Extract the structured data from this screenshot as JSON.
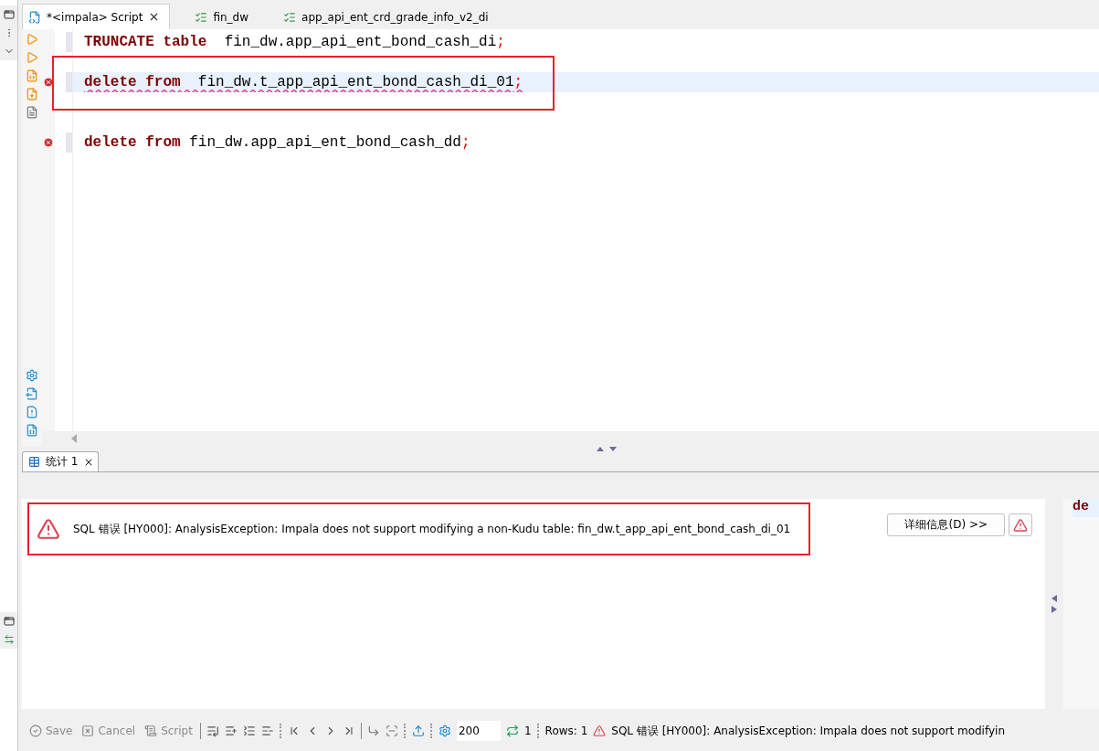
{
  "editor_tabs": [
    {
      "label": "*<impala> Script",
      "kind": "script",
      "selected": true,
      "closable": true
    },
    {
      "label": "fin_dw",
      "kind": "table",
      "selected": false,
      "closable": false
    },
    {
      "label": "app_api_ent_crd_grade_info_v2_di",
      "kind": "table",
      "selected": false,
      "closable": false
    }
  ],
  "code_lines": [
    {
      "kind": "code",
      "error": false,
      "current": false,
      "annotated": false,
      "tokens": [
        {
          "kind": "keyword",
          "text": "TRUNCATE table"
        },
        {
          "kind": "ident",
          "text": "  fin_dw.app_api_ent_bond_cash_di"
        },
        {
          "kind": "punct",
          "text": ";"
        }
      ]
    },
    {
      "kind": "blank"
    },
    {
      "kind": "code",
      "error": true,
      "current": true,
      "annotated": true,
      "tokens": [
        {
          "kind": "keyword",
          "text": "delete from"
        },
        {
          "kind": "ident",
          "text": "  fin_dw.t_app_api_ent_bond_cash_di_01"
        },
        {
          "kind": "punct",
          "text": ";"
        }
      ]
    },
    {
      "kind": "blank"
    },
    {
      "kind": "blank"
    },
    {
      "kind": "code",
      "error": true,
      "current": false,
      "annotated": false,
      "tokens": [
        {
          "kind": "keyword",
          "text": "delete from"
        },
        {
          "kind": "ident",
          "text": " fin_dw.app_api_ent_bond_cash_dd"
        },
        {
          "kind": "punct",
          "text": ";"
        }
      ]
    }
  ],
  "result_tabs": [
    {
      "label": "统计 1",
      "selected": true
    }
  ],
  "error_panel": {
    "message": "SQL 错误 [HY000]: AnalysisException: Impala does not support modifying a non-Kudu table: fin_dw.t_app_api_ent_bond_cash_di_01",
    "annotated": true,
    "details_button": "详细信息(D) >>"
  },
  "side_preview": {
    "text": "de"
  },
  "result_toolbar": {
    "actions": [
      {
        "label": "Save",
        "kind": "save",
        "disabled": true
      },
      {
        "label": "Cancel",
        "kind": "cancel",
        "disabled": true
      },
      {
        "label": "Script",
        "kind": "script",
        "disabled": true
      }
    ],
    "fetch_size": "200",
    "refresh_count": "1",
    "rows": "Rows: 1",
    "status": "SQL 错误 [HY000]: AnalysisException: Impala does not support modifyin"
  }
}
